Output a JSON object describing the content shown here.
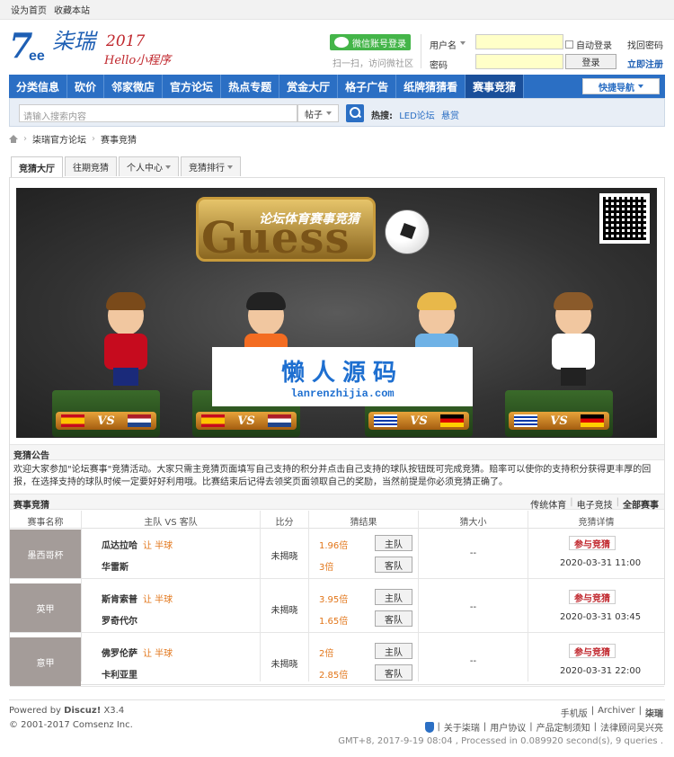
{
  "topbar": {
    "set_home": "设为首页",
    "bookmark": "收藏本站"
  },
  "logo": {
    "seven": "7",
    "tee": "ee",
    "cn": "柒瑞",
    "year": "2017",
    "hello": "Hello小程序"
  },
  "login": {
    "wechat_label": "微信账号登录",
    "wechat_tip": "扫一扫，访问微社区",
    "username_label": "用户名",
    "password_label": "密码",
    "autologin": "自动登录",
    "submit": "登录",
    "find_password": "找回密码",
    "register": "立即注册"
  },
  "nav": {
    "items": [
      "分类信息",
      "砍价",
      "邻家微店",
      "官方论坛",
      "热点专题",
      "赏金大厅",
      "格子广告",
      "纸牌猜猜看",
      "赛事竞猜"
    ],
    "quick_nav": "快捷导航"
  },
  "search": {
    "placeholder": "请输入搜索内容",
    "type": "帖子",
    "hot_label": "热搜:",
    "hot_1": "LED论坛",
    "hot_2": "悬赏"
  },
  "breadcrumb": {
    "forum": "柒瑞官方论坛",
    "page": "赛事竞猜"
  },
  "tabs": [
    "竞猜大厅",
    "往期竞猜",
    "个人中心",
    "竞猜排行"
  ],
  "banner": {
    "guess": "Guess",
    "subtitle": "论坛体育赛事竞猜",
    "vs": "VS"
  },
  "watermark": {
    "cn": "懒人源码",
    "en": "lanrenzhijia.com"
  },
  "announce": {
    "title": "竞猜公告",
    "text": "欢迎大家参加\"论坛赛事\"竞猜活动。大家只需主竞猜页面填写自己支持的积分并点击自己支持的球队按钮既可完成竞猜。赔率可以使你的支持积分获得更丰厚的回报，在选择支持的球队时候一定要好好利用哦。比赛结束后记得去领奖页面领取自己的奖励，当然前提是你必须竞猜正确了。"
  },
  "matches_section": {
    "title": "赛事竞猜",
    "filters": [
      "传统体育",
      "电子竞技",
      "全部赛事"
    ],
    "headers": [
      "赛事名称",
      "主队 VS 客队",
      "比分",
      "猜结果",
      "猜大小",
      "竞猜详情"
    ]
  },
  "matches": [
    {
      "league": "墨西哥杯",
      "home": "瓜达拉哈",
      "handicap": "让 半球",
      "away": "华雷斯",
      "score": "未揭晓",
      "home_odds": "1.96倍",
      "away_odds": "3倍",
      "home_btn": "主队",
      "away_btn": "客队",
      "bigsmall": "--",
      "join": "参与竞猜",
      "time": "2020-03-31 11:00"
    },
    {
      "league": "英甲",
      "home": "斯肯索普",
      "handicap": "让 半球",
      "away": "罗奇代尔",
      "score": "未揭晓",
      "home_odds": "3.95倍",
      "away_odds": "1.65倍",
      "home_btn": "主队",
      "away_btn": "客队",
      "bigsmall": "--",
      "join": "参与竞猜",
      "time": "2020-03-31 03:45"
    },
    {
      "league": "意甲",
      "home": "佛罗伦萨",
      "handicap": "让 半球",
      "away": "卡利亚里",
      "score": "未揭晓",
      "home_odds": "2倍",
      "away_odds": "2.85倍",
      "home_btn": "主队",
      "away_btn": "客队",
      "bigsmall": "--",
      "join": "参与竞猜",
      "time": "2020-03-31 22:00"
    }
  ],
  "footer": {
    "powered": "Powered by",
    "discuz": "Discuz!",
    "version": "X3.4",
    "copyright": "© 2001-2017",
    "company": "Comsenz Inc.",
    "links_1": [
      "手机版",
      "Archiver",
      "柒瑞"
    ],
    "links_2": [
      "关于柒瑞",
      "用户协议",
      "产品定制须知",
      "法律顾问吴兴亮"
    ],
    "stats": "GMT+8, 2017-9-19 08:04 , Processed in 0.089920 second(s), 9 queries ."
  },
  "colors": {
    "nav_blue": "#2b6fc4",
    "odds_orange": "#e2761a",
    "join_red": "#c0272d",
    "league_bg": "#a49c99"
  }
}
